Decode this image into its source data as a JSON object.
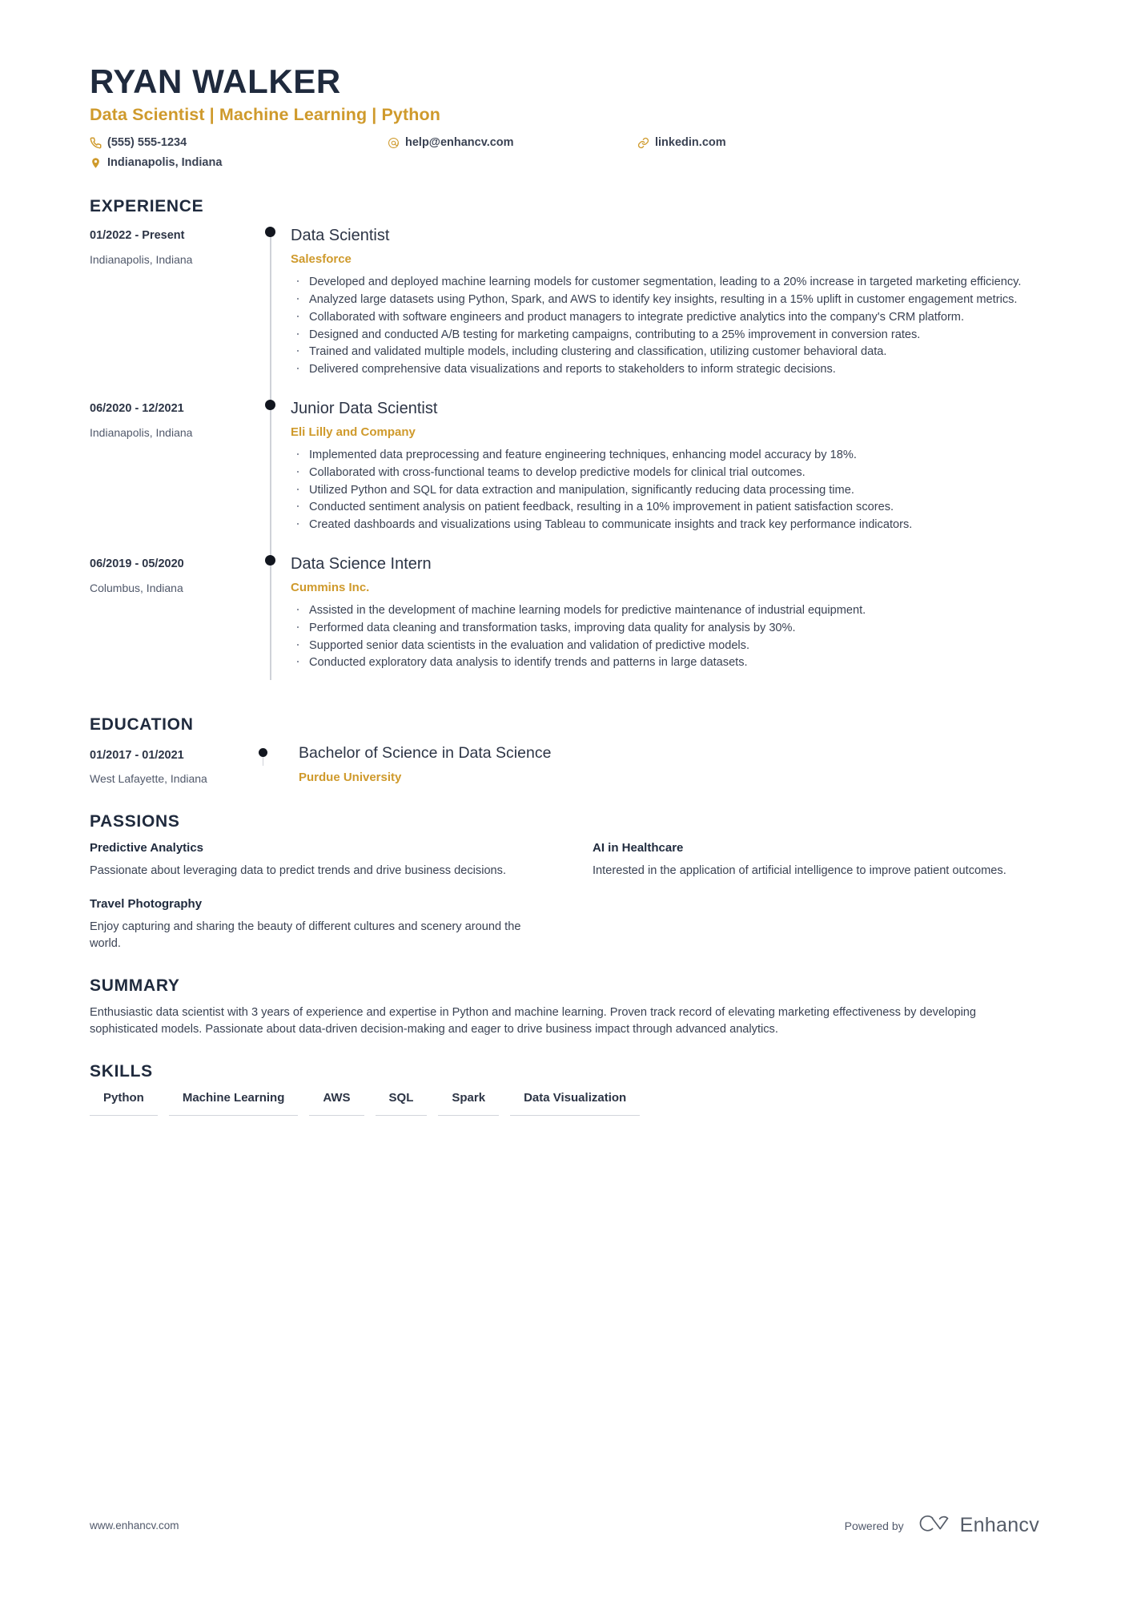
{
  "header": {
    "name": "RYAN WALKER",
    "headline": "Data Scientist | Machine Learning | Python",
    "contacts": [
      {
        "icon": "phone-icon",
        "text": "(555) 555-1234"
      },
      {
        "icon": "email-icon",
        "text": "help@enhancv.com"
      },
      {
        "icon": "link-icon",
        "text": "linkedin.com"
      },
      {
        "icon": "location-icon",
        "text": "Indianapolis, Indiana"
      }
    ]
  },
  "colors": {
    "accent": "#cf9a2c",
    "ink": "#1f2a3d",
    "body": "#3a4253",
    "rule": "#d2d5db"
  },
  "sections": {
    "experience_title": "EXPERIENCE",
    "education_title": "EDUCATION",
    "passions_title": "PASSIONS",
    "summary_title": "SUMMARY",
    "skills_title": "SKILLS"
  },
  "experience": [
    {
      "date": "01/2022 - Present",
      "location": "Indianapolis, Indiana",
      "title": "Data Scientist",
      "org": "Salesforce",
      "bullets": [
        "Developed and deployed machine learning models for customer segmentation, leading to a 20% increase in targeted marketing efficiency.",
        "Analyzed large datasets using Python, Spark, and AWS to identify key insights, resulting in a 15% uplift in customer engagement metrics.",
        "Collaborated with software engineers and product managers to integrate predictive analytics into the company's CRM platform.",
        "Designed and conducted A/B testing for marketing campaigns, contributing to a 25% improvement in conversion rates.",
        "Trained and validated multiple models, including clustering and classification, utilizing customer behavioral data.",
        "Delivered comprehensive data visualizations and reports to stakeholders to inform strategic decisions."
      ]
    },
    {
      "date": "06/2020 - 12/2021",
      "location": "Indianapolis, Indiana",
      "title": "Junior Data Scientist",
      "org": "Eli Lilly and Company",
      "bullets": [
        "Implemented data preprocessing and feature engineering techniques, enhancing model accuracy by 18%.",
        "Collaborated with cross-functional teams to develop predictive models for clinical trial outcomes.",
        "Utilized Python and SQL for data extraction and manipulation, significantly reducing data processing time.",
        "Conducted sentiment analysis on patient feedback, resulting in a 10% improvement in patient satisfaction scores.",
        "Created dashboards and visualizations using Tableau to communicate insights and track key performance indicators."
      ]
    },
    {
      "date": "06/2019 - 05/2020",
      "location": "Columbus, Indiana",
      "title": "Data Science Intern",
      "org": "Cummins Inc.",
      "bullets": [
        "Assisted in the development of machine learning models for predictive maintenance of industrial equipment.",
        "Performed data cleaning and transformation tasks, improving data quality for analysis by 30%.",
        "Supported senior data scientists in the evaluation and validation of predictive models.",
        "Conducted exploratory data analysis to identify trends and patterns in large datasets."
      ]
    }
  ],
  "education": [
    {
      "date": "01/2017 - 01/2021",
      "location": "West Lafayette, Indiana",
      "title": "Bachelor of Science in Data Science",
      "org": "Purdue University"
    }
  ],
  "passions": [
    {
      "title": "Predictive Analytics",
      "text": "Passionate about leveraging data to predict trends and drive business decisions."
    },
    {
      "title": "AI in Healthcare",
      "text": "Interested in the application of artificial intelligence to improve patient outcomes."
    },
    {
      "title": "Travel Photography",
      "text": "Enjoy capturing and sharing the beauty of different cultures and scenery around the world."
    }
  ],
  "summary": "Enthusiastic data scientist with 3 years of experience and expertise in Python and machine learning. Proven track record of elevating marketing effectiveness by developing sophisticated models. Passionate about data-driven decision-making and eager to drive business impact through advanced analytics.",
  "skills": [
    "Python",
    "Machine Learning",
    "AWS",
    "SQL",
    "Spark",
    "Data Visualization"
  ],
  "footer": {
    "url": "www.enhancv.com",
    "powered_by": "Powered by",
    "brand": "Enhancv"
  }
}
